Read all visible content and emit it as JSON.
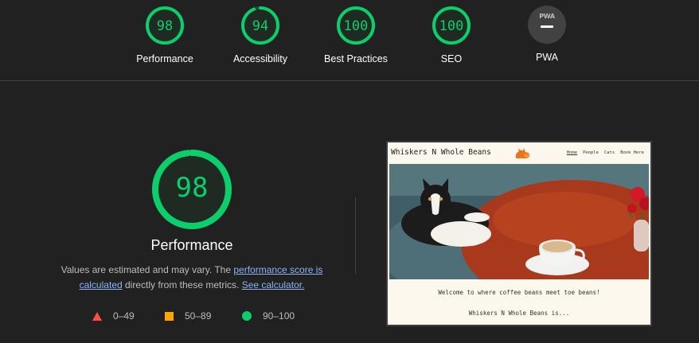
{
  "categories": [
    {
      "label": "Performance",
      "score": "98",
      "value": 98
    },
    {
      "label": "Accessibility",
      "score": "94",
      "value": 94
    },
    {
      "label": "Best Practices",
      "score": "100",
      "value": 100
    },
    {
      "label": "SEO",
      "score": "100",
      "value": 100
    }
  ],
  "pwa": {
    "label": "PWA",
    "badge_text": "PWA"
  },
  "main": {
    "score": "98",
    "value": 98,
    "title": "Performance",
    "desc_prefix": "Values are estimated and may vary. The ",
    "link_score": "performance score is calculated",
    "desc_middle": " directly from these metrics. ",
    "link_calc": "See calculator."
  },
  "legend": [
    {
      "range": "0–49",
      "symbol": "triangle",
      "color": "#ff4e42"
    },
    {
      "range": "50–89",
      "symbol": "square",
      "color": "#ffa400"
    },
    {
      "range": "90–100",
      "symbol": "circle",
      "color": "#0cce6b"
    }
  ],
  "colors": {
    "pass": "#0cce6b",
    "background": "#212121",
    "link": "#8ab4f8"
  },
  "site": {
    "title": "Whiskers N Whole Beans",
    "nav": [
      "Home",
      "People",
      "Cats",
      "Book Here"
    ],
    "tagline": "Welcome to where coffee beans meet toe beans!",
    "intro": "Whiskers N Whole Beans is..."
  }
}
